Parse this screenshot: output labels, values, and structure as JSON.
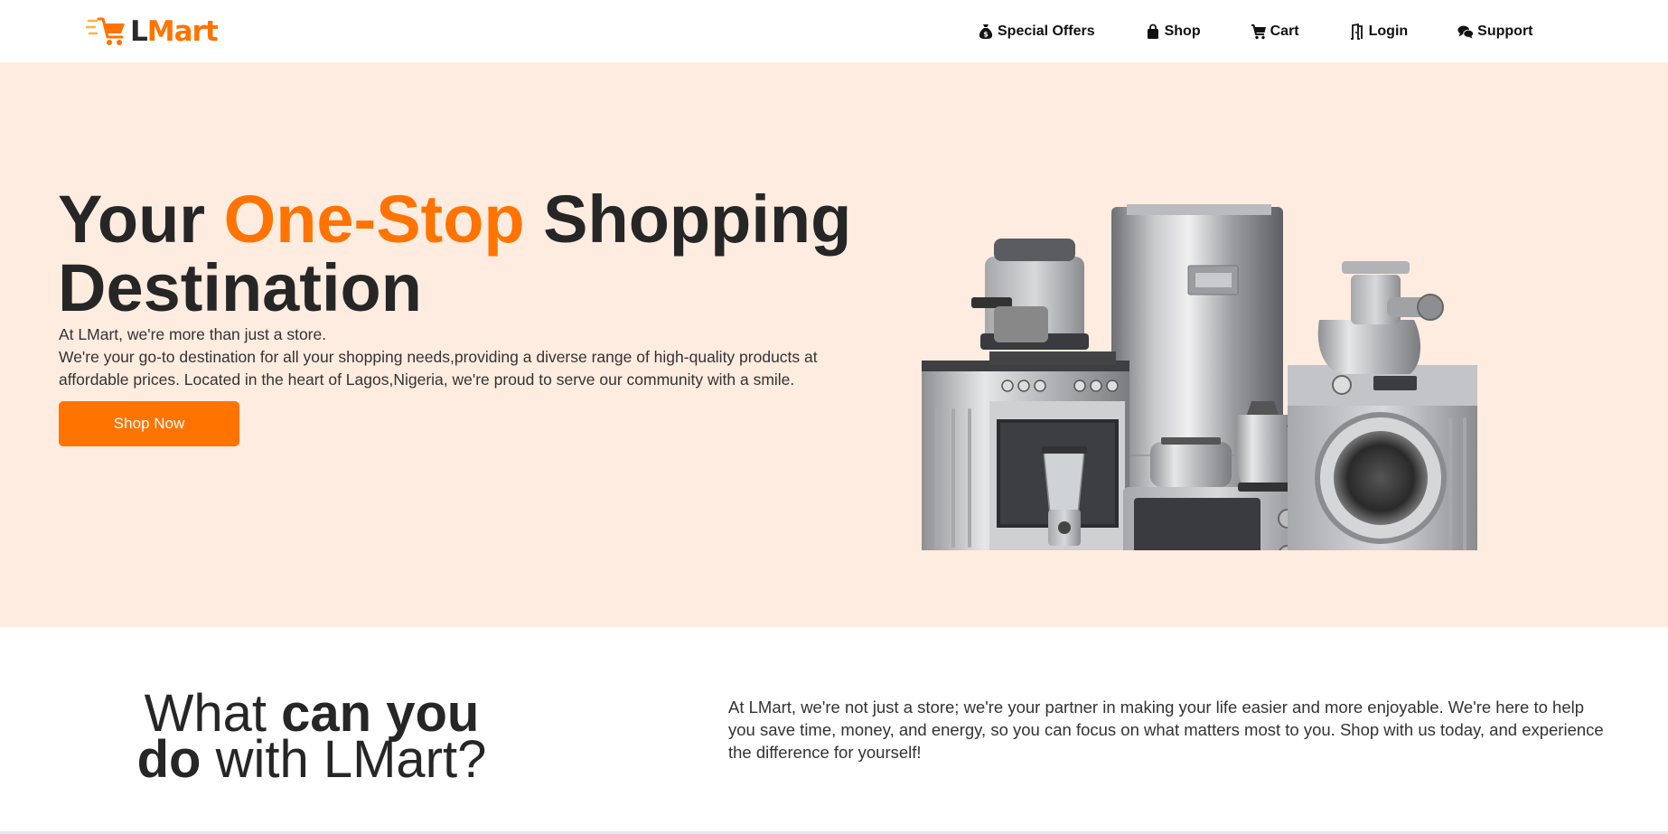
{
  "brand": {
    "prefix": "L",
    "suffix": "Mart",
    "accent_color": "#ff7300",
    "dark_color": "#2a2a2a"
  },
  "nav": {
    "items": [
      {
        "icon": "money-bag-icon",
        "label": "Special Offers"
      },
      {
        "icon": "shopping-bag-icon",
        "label": "Shop"
      },
      {
        "icon": "cart-icon",
        "label": "Cart"
      },
      {
        "icon": "door-icon",
        "label": "Login"
      },
      {
        "icon": "chat-bubbles-icon",
        "label": "Support"
      }
    ]
  },
  "hero": {
    "title_part1": "Your ",
    "title_accent": "One-Stop",
    "title_part2": " Shopping Destination",
    "line1": "At LMart, we're more than just a store.",
    "line2": "We're your go-to destination for all your shopping needs,providing a diverse range of high-quality products at affordable prices. Located in the heart of Lagos,Nigeria, we're proud to serve our community with a smile.",
    "cta_label": "Shop Now",
    "background_color": "#ffece0",
    "image_alt": "home-appliances-image"
  },
  "about": {
    "title_light1": "What ",
    "title_bold1": "can you",
    "title_bold2": "do",
    "title_light2": " with LMart?",
    "body": "At LMart, we're not just a store; we're your partner in making your life easier and more enjoyable. We're here to help you save time, money, and energy, so you can focus on what matters most to you. Shop with us today, and experience the difference for yourself!"
  }
}
